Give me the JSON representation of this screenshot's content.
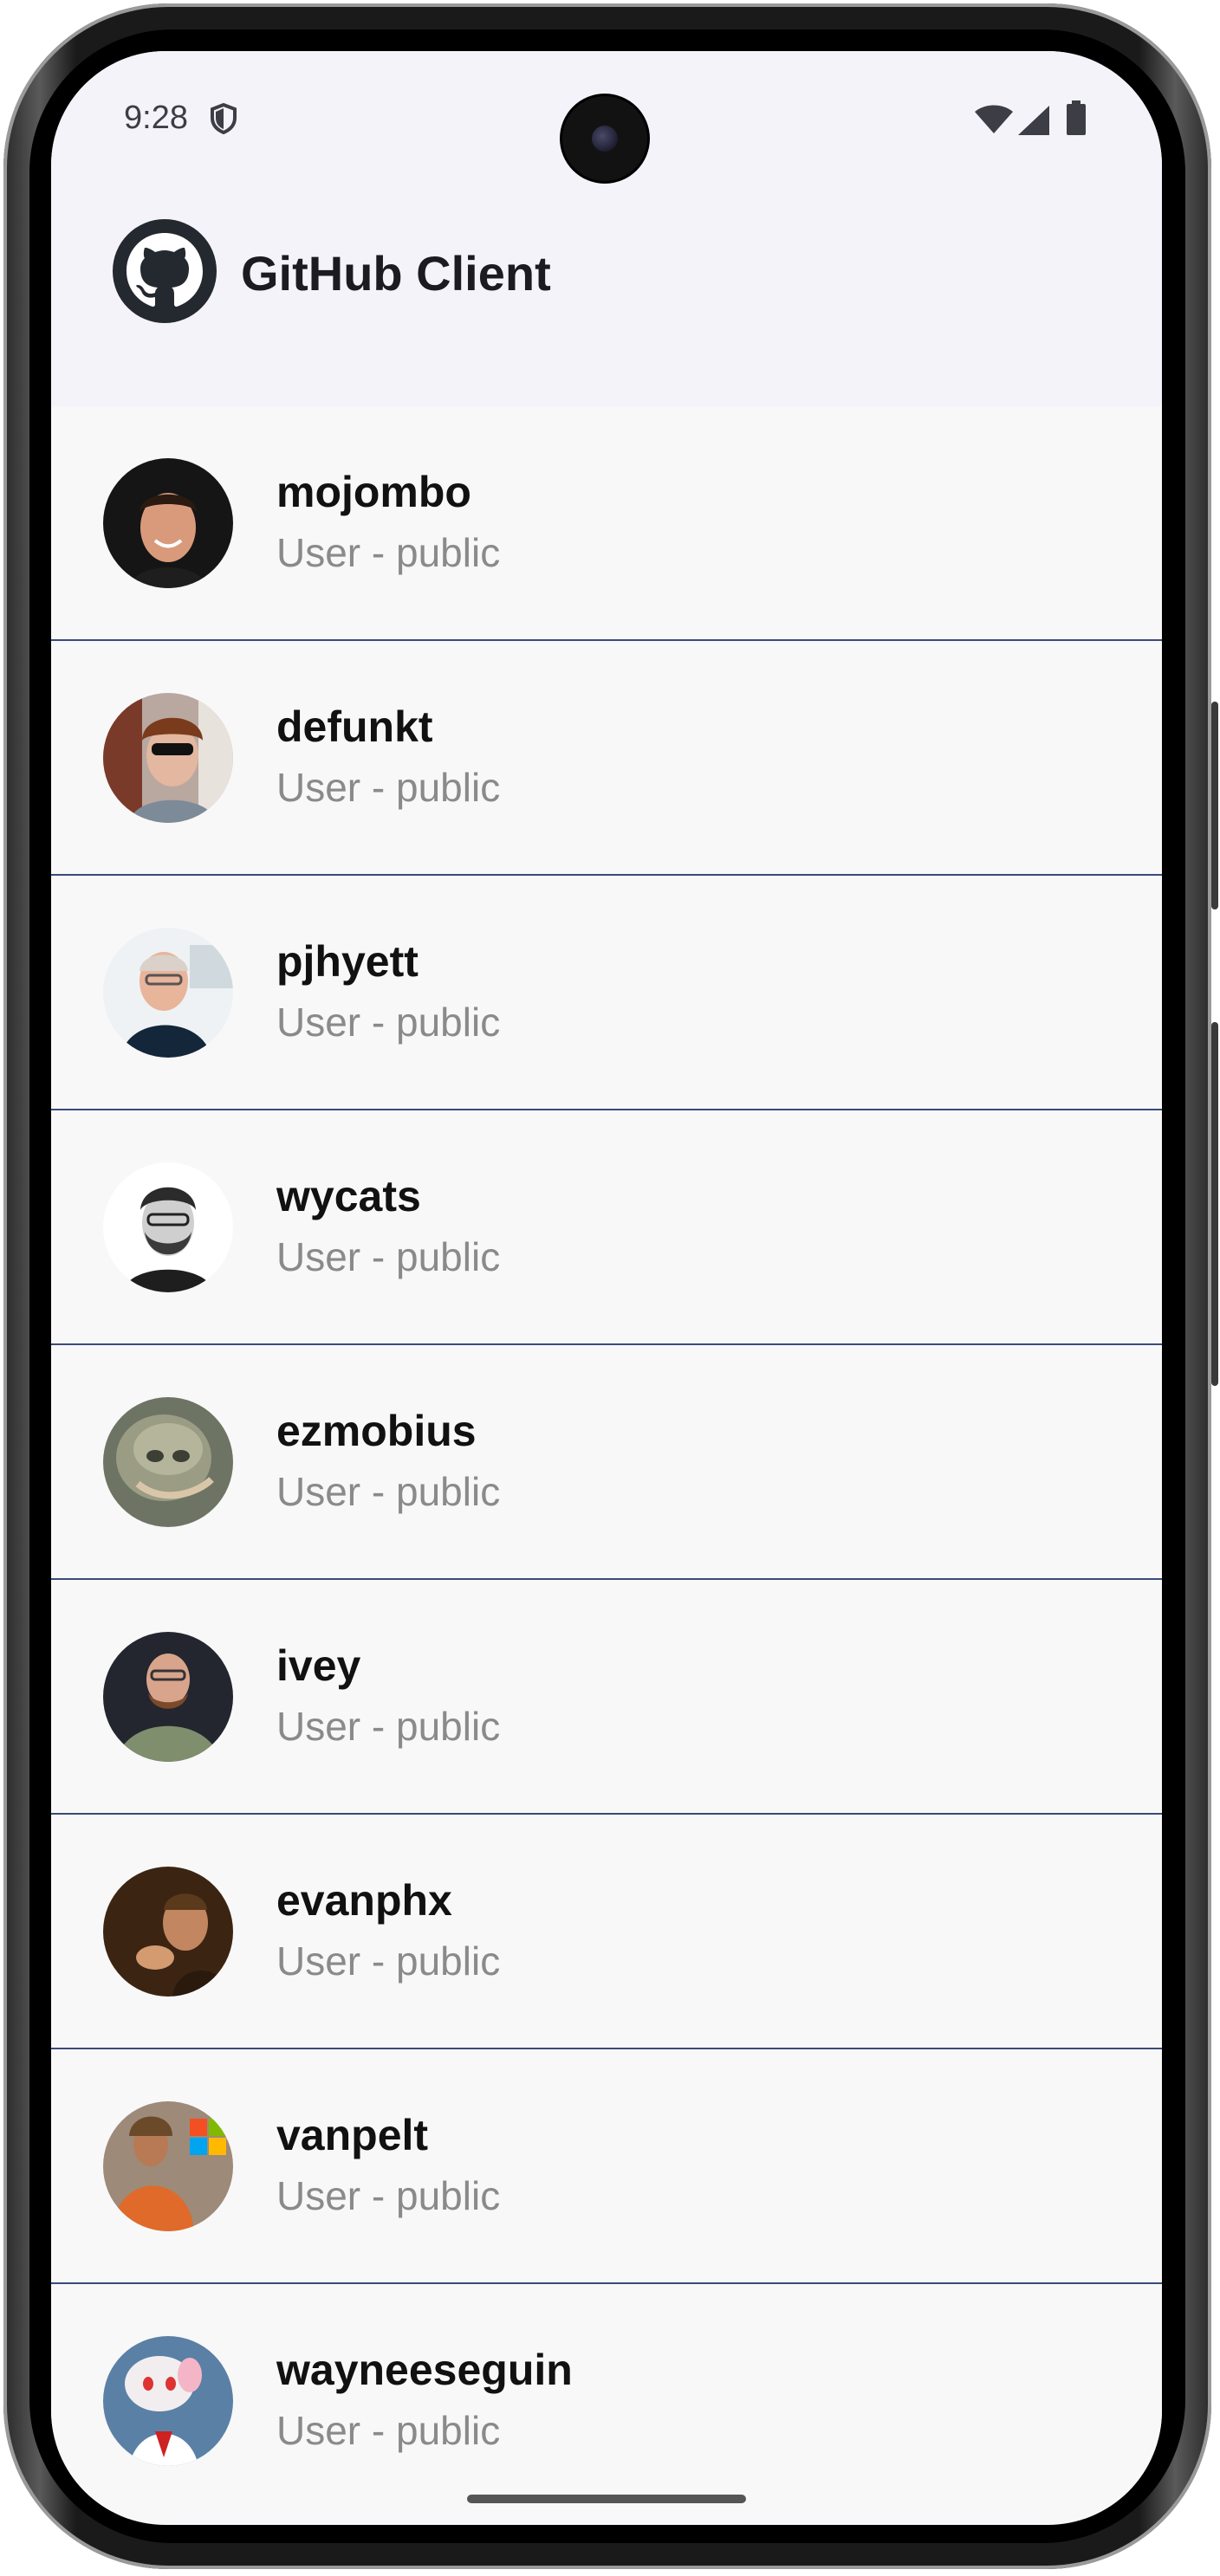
{
  "status_bar": {
    "time": "9:28",
    "icons": [
      "shield-icon",
      "wifi-icon",
      "signal-icon",
      "battery-icon"
    ]
  },
  "app_bar": {
    "title": "GitHub Client",
    "logo_icon": "github-logo-icon"
  },
  "colors": {
    "divider": "#3b4a7a",
    "app_bar_bg": "#f5f3fa",
    "subtitle": "#8a8a8a"
  },
  "users": [
    {
      "login": "mojombo",
      "subtitle": "User - public"
    },
    {
      "login": "defunkt",
      "subtitle": "User - public"
    },
    {
      "login": "pjhyett",
      "subtitle": "User - public"
    },
    {
      "login": "wycats",
      "subtitle": "User - public"
    },
    {
      "login": "ezmobius",
      "subtitle": "User - public"
    },
    {
      "login": "ivey",
      "subtitle": "User - public"
    },
    {
      "login": "evanphx",
      "subtitle": "User - public"
    },
    {
      "login": "vanpelt",
      "subtitle": "User - public"
    },
    {
      "login": "wayneeseguin",
      "subtitle": "User - public"
    }
  ]
}
